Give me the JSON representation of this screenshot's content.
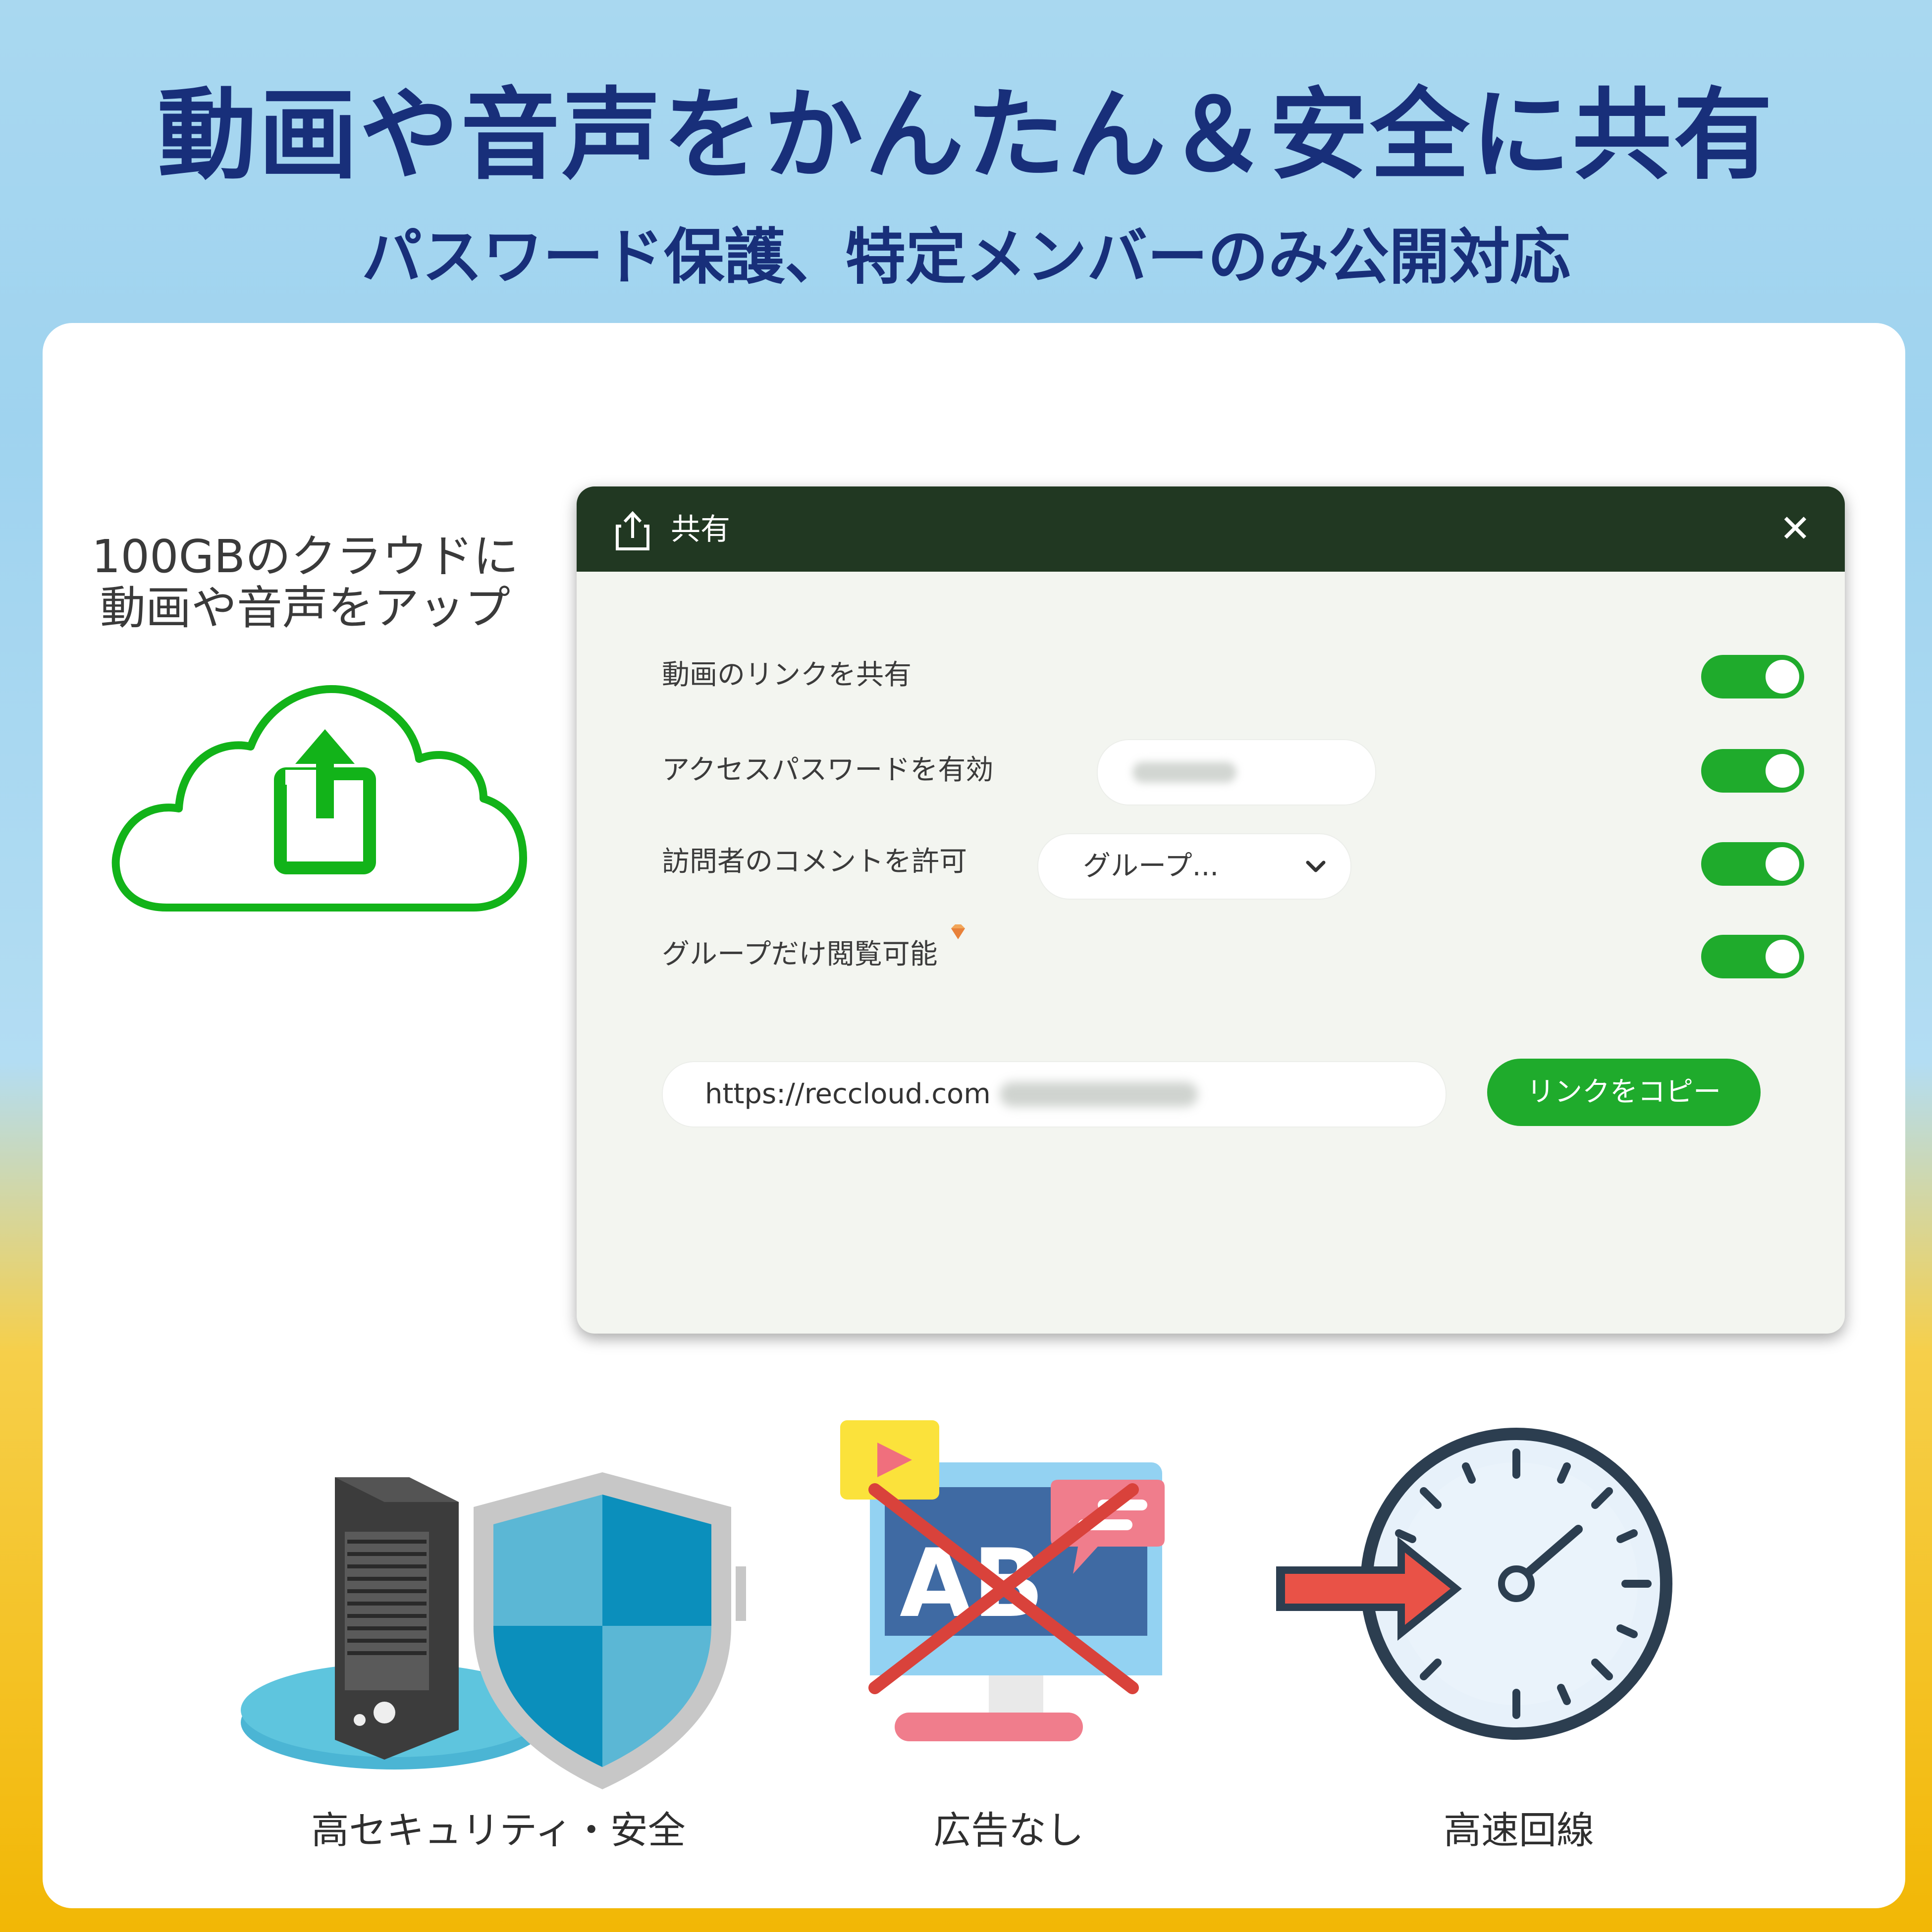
{
  "banner": {
    "headline": "動画や音声をかんたん＆安全に共有",
    "subheadline": "パスワード保護、特定メンバーのみ公開対応"
  },
  "cloud": {
    "caption_line1": "100GBのクラウドに",
    "caption_line2": "動画や音声をアップ",
    "icon": "cloud-upload-icon"
  },
  "dialog": {
    "title": "共有",
    "title_icon": "share-icon",
    "close_label": "✕",
    "rows": [
      {
        "label": "動画のリンクを共有",
        "enabled": true
      },
      {
        "label": "アクセスパスワードを有効",
        "enabled": true
      },
      {
        "label": "訪問者のコメントを許可",
        "enabled": true
      },
      {
        "label": "グループだけ閲覧可能",
        "enabled": true
      }
    ],
    "group_select_value": "グループ...",
    "url_prefix": "https://reccloud.com",
    "copy_button": "リンクをコピー"
  },
  "features": [
    {
      "label": "高セキュリティ・安全",
      "icon": "server-shield-icon"
    },
    {
      "label": "広告なし",
      "icon": "no-ads-monitor-icon"
    },
    {
      "label": "高速回線",
      "icon": "speed-clock-icon"
    }
  ],
  "colors": {
    "headline": "#182f7a",
    "toggle_on": "#1fab2c",
    "dialog_bar": "#213822",
    "cloud_stroke": "#12b319"
  }
}
